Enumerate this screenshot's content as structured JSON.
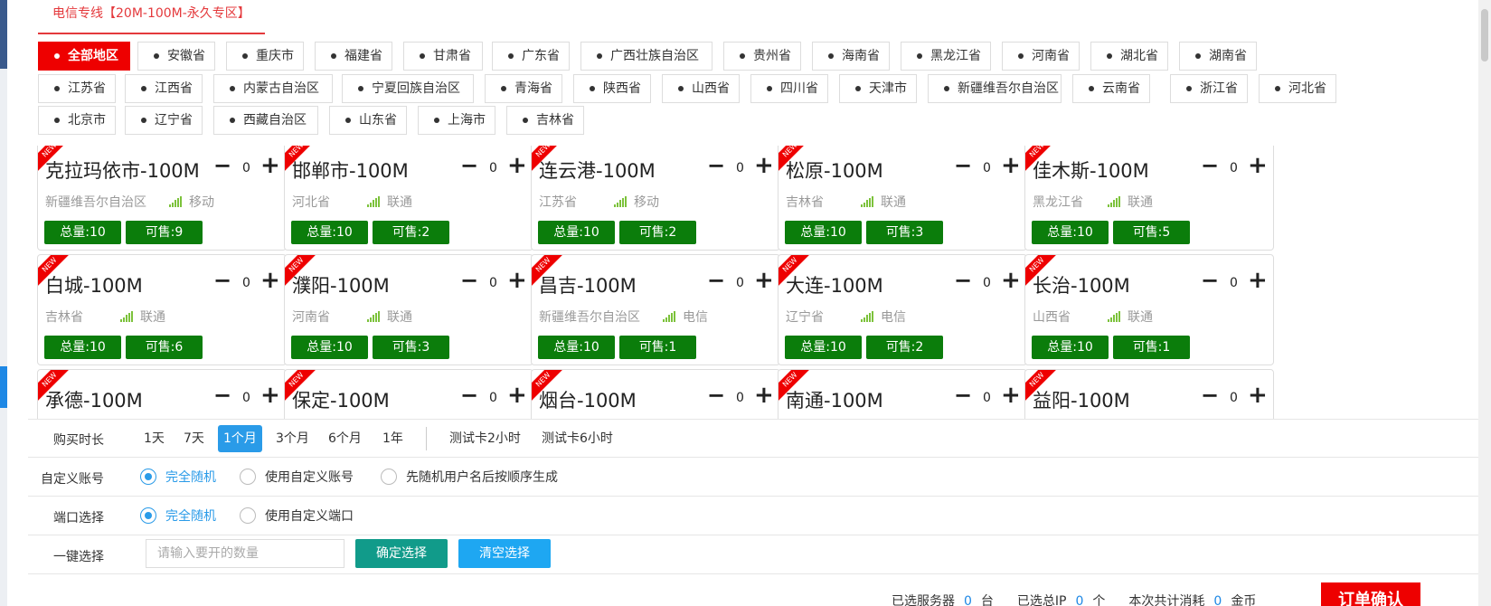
{
  "tab": {
    "label": "电信专线【20M-100M-永久专区】"
  },
  "regions": [
    {
      "label": "全部地区",
      "active": true
    },
    {
      "label": "安徽省"
    },
    {
      "label": "重庆市"
    },
    {
      "label": "福建省"
    },
    {
      "label": "甘肃省"
    },
    {
      "label": "广东省"
    },
    {
      "label": "广西壮族自治区"
    },
    {
      "label": "贵州省"
    },
    {
      "label": "海南省"
    },
    {
      "label": "黑龙江省"
    },
    {
      "label": "河南省"
    },
    {
      "label": "湖北省"
    },
    {
      "label": "湖南省"
    },
    {
      "label": "江苏省"
    },
    {
      "label": "江西省"
    },
    {
      "label": "内蒙古自治区"
    },
    {
      "label": "宁夏回族自治区"
    },
    {
      "label": "青海省"
    },
    {
      "label": "陕西省"
    },
    {
      "label": "山西省"
    },
    {
      "label": "四川省"
    },
    {
      "label": "天津市"
    },
    {
      "label": "新疆维吾尔自治区"
    },
    {
      "label": "云南省"
    },
    {
      "label": "浙江省"
    },
    {
      "label": "河北省"
    },
    {
      "label": "北京市"
    },
    {
      "label": "辽宁省"
    },
    {
      "label": "西藏自治区"
    },
    {
      "label": "山东省"
    },
    {
      "label": "上海市"
    },
    {
      "label": "吉林省"
    }
  ],
  "badge_new": "NEW",
  "cards": [
    {
      "name": "克拉玛依市-100M",
      "qty": "0",
      "province": "新疆维吾尔自治区",
      "isp": "移动",
      "total": "总量:10",
      "avail": "可售:9"
    },
    {
      "name": "邯郸市-100M",
      "qty": "0",
      "province": "河北省",
      "isp": "联通",
      "total": "总量:10",
      "avail": "可售:2"
    },
    {
      "name": "连云港-100M",
      "qty": "0",
      "province": "江苏省",
      "isp": "移动",
      "total": "总量:10",
      "avail": "可售:2"
    },
    {
      "name": "松原-100M",
      "qty": "0",
      "province": "吉林省",
      "isp": "联通",
      "total": "总量:10",
      "avail": "可售:3"
    },
    {
      "name": "佳木斯-100M",
      "qty": "0",
      "province": "黑龙江省",
      "isp": "联通",
      "total": "总量:10",
      "avail": "可售:5"
    },
    {
      "name": "白城-100M",
      "qty": "0",
      "province": "吉林省",
      "isp": "联通",
      "total": "总量:10",
      "avail": "可售:6"
    },
    {
      "name": "濮阳-100M",
      "qty": "0",
      "province": "河南省",
      "isp": "联通",
      "total": "总量:10",
      "avail": "可售:3"
    },
    {
      "name": "昌吉-100M",
      "qty": "0",
      "province": "新疆维吾尔自治区",
      "isp": "电信",
      "total": "总量:10",
      "avail": "可售:1"
    },
    {
      "name": "大连-100M",
      "qty": "0",
      "province": "辽宁省",
      "isp": "电信",
      "total": "总量:10",
      "avail": "可售:2"
    },
    {
      "name": "长治-100M",
      "qty": "0",
      "province": "山西省",
      "isp": "联通",
      "total": "总量:10",
      "avail": "可售:1"
    },
    {
      "name": "承德-100M",
      "qty": "0"
    },
    {
      "name": "保定-100M",
      "qty": "0"
    },
    {
      "name": "烟台-100M",
      "qty": "0"
    },
    {
      "name": "南通-100M",
      "qty": "0"
    },
    {
      "name": "益阳-100M",
      "qty": "0"
    }
  ],
  "duration": {
    "label": "购买时长",
    "options": [
      {
        "label": "1天"
      },
      {
        "label": "7天"
      },
      {
        "label": "1个月",
        "active": true
      },
      {
        "label": "3个月"
      },
      {
        "label": "6个月"
      },
      {
        "label": "1年"
      },
      {
        "label": "测试卡2小时"
      },
      {
        "label": "测试卡6小时"
      }
    ]
  },
  "account": {
    "label": "自定义账号",
    "options": [
      {
        "label": "完全随机",
        "checked": true
      },
      {
        "label": "使用自定义账号"
      },
      {
        "label": "先随机用户名后按顺序生成"
      }
    ]
  },
  "port": {
    "label": "端口选择",
    "options": [
      {
        "label": "完全随机",
        "checked": true
      },
      {
        "label": "使用自定义端口"
      }
    ]
  },
  "quick": {
    "label": "一键选择",
    "placeholder": "请输入要开的数量",
    "confirm": "确定选择",
    "clear": "清空选择"
  },
  "summary": {
    "servers_label": "已选服务器",
    "servers": "0",
    "servers_unit": "台",
    "ips_label": "已选总IP",
    "ips": "0",
    "ips_unit": "个",
    "cost_label": "本次共计消耗",
    "cost": "0",
    "cost_unit": "金币"
  },
  "order_button": "订单确认",
  "colors": {
    "accent_red": "#e00000",
    "green_badge": "#0b7d0b",
    "blue": "#2a9be8",
    "teal": "#119b8a"
  }
}
